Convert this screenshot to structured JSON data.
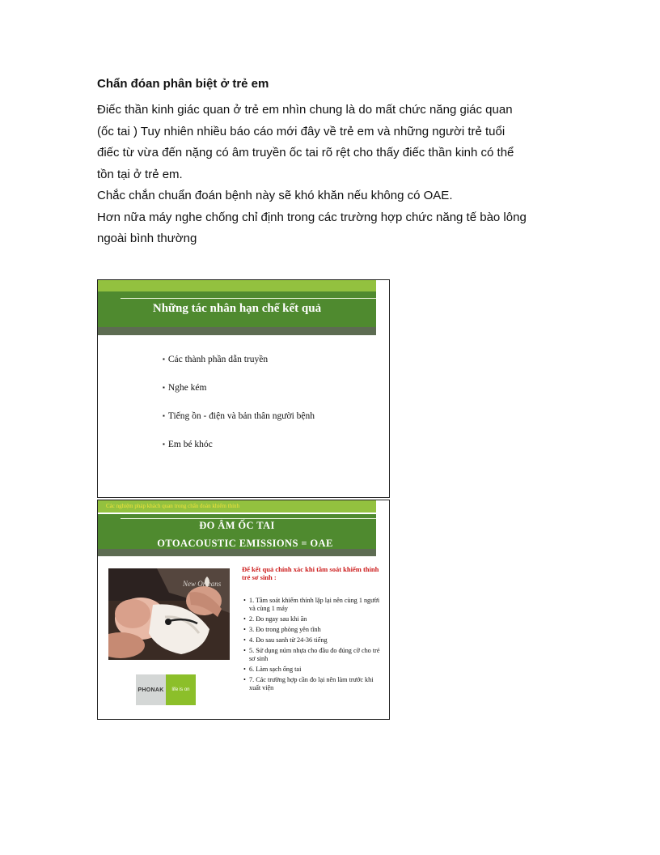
{
  "document": {
    "heading": "Chẩn đóan phân biệt ở trẻ em",
    "paragraph_lines": [
      " Điếc thần kinh giác quan ở trẻ em nhìn chung là do mất chức năng giác quan",
      "(ốc tai ) Tuy nhiên nhiều báo cáo mới đây về  trẻ em và những người trẻ tuổi",
      "điếc từ vừa đến nặng có âm truyền ốc tai rõ rệt cho thấy điếc thần kinh có thể",
      "tồn tại ở trẻ em.",
      "Chắc chắn chuẩn đoán bệnh này sẽ khó khăn nếu không có OAE.",
      "Hơn nữa máy nghe chống chỉ định trong các trường hợp chức năng tế bào lông",
      "ngoài bình thường"
    ]
  },
  "slide1": {
    "title": "Những tác nhân hạn chế kết quả",
    "bullets": [
      "Các thành phần dẫn truyền",
      "Nghe kém",
      "Tiếng ồn - điện và bản thân người bệnh",
      "Em bé khóc"
    ]
  },
  "slide2": {
    "caption": "Các nghiệm pháp khách quan trong chẩn đoán khiếm thính",
    "title_line1": "ĐO ÂM ỐC TAI",
    "title_line2": "OTOACOUSTIC  EMISSIONS  = OAE",
    "red_heading": "Để kết quả chính xác khi tầm soát khiếm thính trẻ sơ sinh :",
    "bullets": [
      "1. Tầm soát khiếm thính lặp lại nên cùng 1 người và cùng 1 máy",
      "2. Đo ngay sau khi ăn",
      "3. Đo trong phòng yên tĩnh",
      "4. Đo sau sanh từ 24-36 tiếng",
      "5. Sử dụng núm nhựa cho đầu đo đúng cỡ cho trẻ sơ sinh",
      "6. Làm sạch ống tai",
      "7. Các trường hợp cần đo lại nên làm trước khi xuất viện"
    ],
    "logo_brand": "PHONAK",
    "logo_tagline": "life is on"
  },
  "colors": {
    "light_green": "#93c13f",
    "dark_green": "#4f8a2f",
    "gray_green": "#5d6c52",
    "red": "#cc1b1b",
    "caption_yellow": "#f2e33c"
  }
}
